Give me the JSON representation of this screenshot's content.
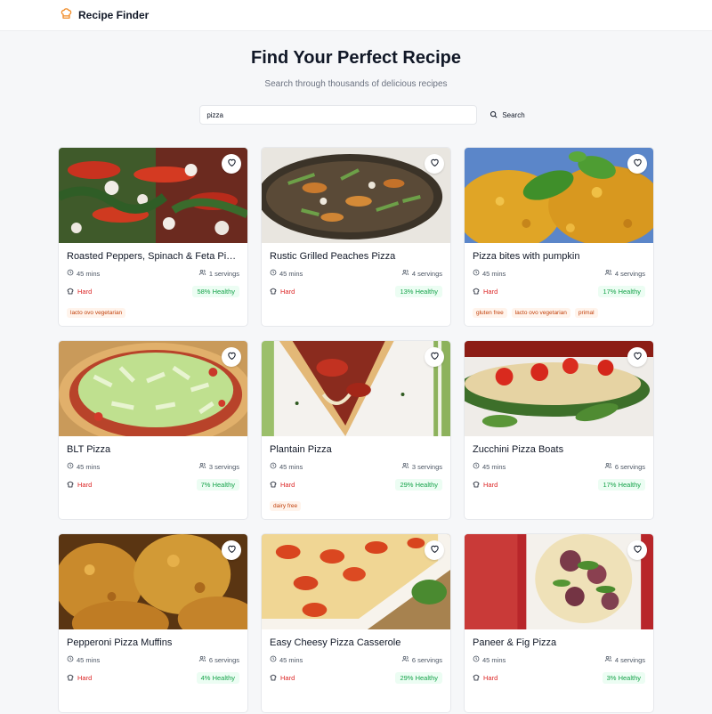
{
  "app": {
    "name": "Recipe Finder",
    "logo_icon": "chef-hat-icon"
  },
  "hero": {
    "title": "Find Your Perfect Recipe",
    "subtitle": "Search through thousands of delicious recipes"
  },
  "search": {
    "value": "pizza",
    "button_label": "Search",
    "button_icon": "search-icon"
  },
  "colors": {
    "difficulty_hard": "#dc2626",
    "healthy": "#16a34a",
    "tag_text": "#c2410c",
    "tag_bg": "#fff4ec"
  },
  "recipes": [
    {
      "title": "Roasted Peppers, Spinach & Feta Pizza",
      "time": "45 mins",
      "servings": "1 servings",
      "difficulty": "Hard",
      "healthy": "58% Healthy",
      "tags": [
        "lacto ovo vegetarian"
      ]
    },
    {
      "title": "Rustic Grilled Peaches Pizza",
      "time": "45 mins",
      "servings": "4 servings",
      "difficulty": "Hard",
      "healthy": "13% Healthy",
      "tags": []
    },
    {
      "title": "Pizza bites with pumpkin",
      "time": "45 mins",
      "servings": "4 servings",
      "difficulty": "Hard",
      "healthy": "17% Healthy",
      "tags": [
        "gluten free",
        "lacto ovo vegetarian",
        "primal"
      ]
    },
    {
      "title": "BLT Pizza",
      "time": "45 mins",
      "servings": "3 servings",
      "difficulty": "Hard",
      "healthy": "7% Healthy",
      "tags": []
    },
    {
      "title": "Plantain Pizza",
      "time": "45 mins",
      "servings": "3 servings",
      "difficulty": "Hard",
      "healthy": "29% Healthy",
      "tags": [
        "dairy free"
      ]
    },
    {
      "title": "Zucchini Pizza Boats",
      "time": "45 mins",
      "servings": "6 servings",
      "difficulty": "Hard",
      "healthy": "17% Healthy",
      "tags": []
    },
    {
      "title": "Pepperoni Pizza Muffins",
      "time": "45 mins",
      "servings": "6 servings",
      "difficulty": "Hard",
      "healthy": "4% Healthy",
      "tags": []
    },
    {
      "title": "Easy Cheesy Pizza Casserole",
      "time": "45 mins",
      "servings": "6 servings",
      "difficulty": "Hard",
      "healthy": "29% Healthy",
      "tags": []
    },
    {
      "title": "Paneer & Fig Pizza",
      "time": "45 mins",
      "servings": "4 servings",
      "difficulty": "Hard",
      "healthy": "3% Healthy",
      "tags": []
    }
  ]
}
